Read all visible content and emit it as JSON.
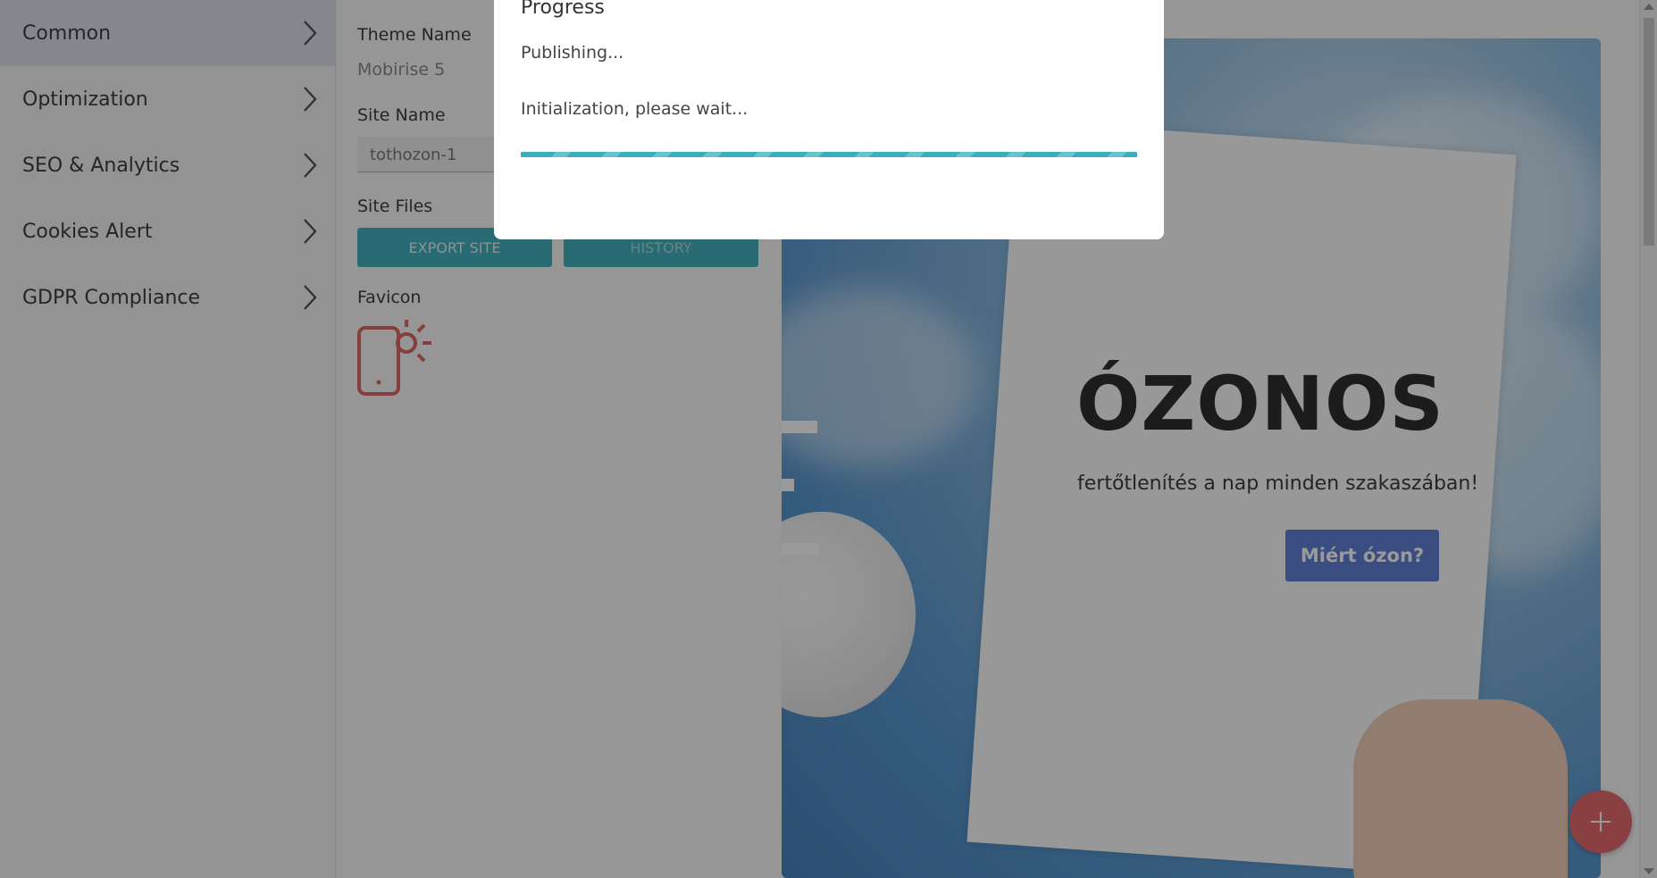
{
  "sidebar": {
    "items": [
      {
        "label": "Common",
        "active": true
      },
      {
        "label": "Optimization",
        "active": false
      },
      {
        "label": "SEO & Analytics",
        "active": false
      },
      {
        "label": "Cookies Alert",
        "active": false
      },
      {
        "label": "GDPR Compliance",
        "active": false
      }
    ]
  },
  "panel": {
    "theme_name_label": "Theme Name",
    "theme_name_value": "Mobirise 5",
    "site_name_label": "Site Name",
    "site_name_value": "tothozon-1",
    "site_files_label": "Site Files",
    "export_button": "EXPORT SITE",
    "history_button": "HISTORY",
    "favicon_label": "Favicon",
    "favicon_icon": "phone-sun-icon"
  },
  "preview": {
    "hero_title": "ÓZONOS",
    "hero_subtitle": "fertőtlenítés a nap minden szakaszában!",
    "hero_button": "Miért ózon?"
  },
  "modal": {
    "title": "Progress",
    "status": "Publishing...",
    "message": "Initialization, please wait...",
    "progress": 1.0
  },
  "fab": {
    "icon": "plus-icon"
  },
  "colors": {
    "accent": "#2aa7b6",
    "hero_button": "#4a6fcf",
    "fab": "#e05555",
    "favicon": "#d9534f"
  }
}
